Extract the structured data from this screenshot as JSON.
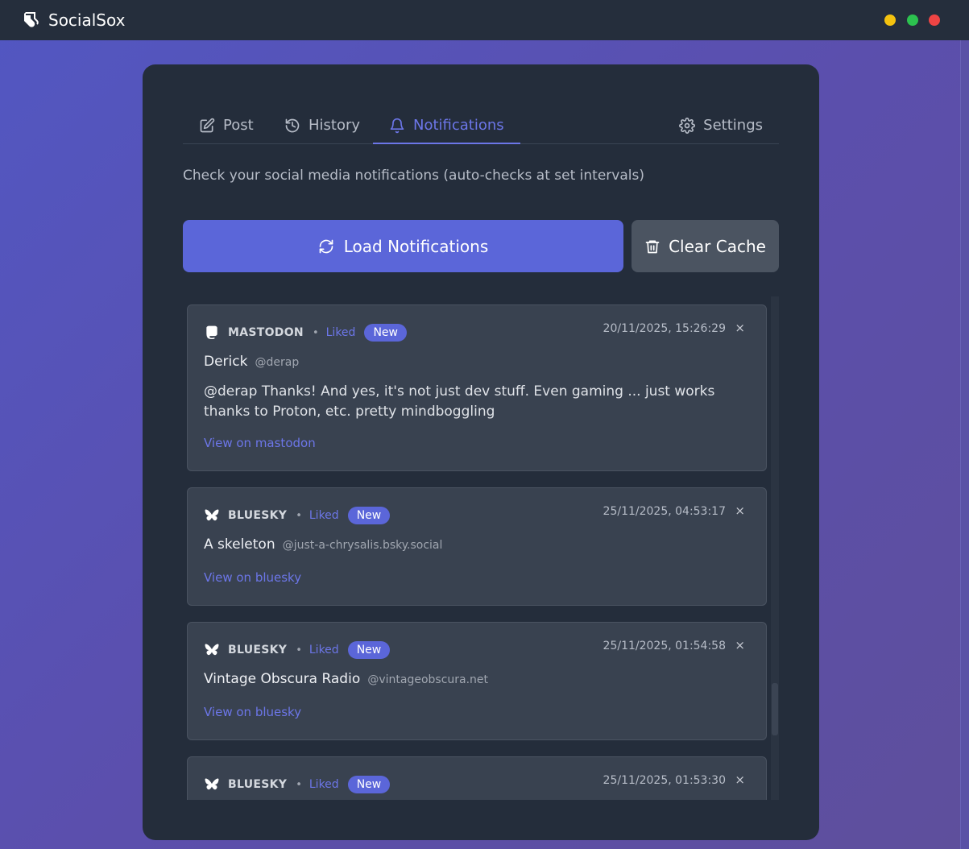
{
  "window": {
    "title": "SocialSox",
    "controls": [
      "minimize",
      "maximize",
      "close"
    ]
  },
  "tabs": [
    {
      "label": "Post",
      "icon": "edit-icon",
      "active": false
    },
    {
      "label": "History",
      "icon": "history-icon",
      "active": false
    },
    {
      "label": "Notifications",
      "icon": "bell-icon",
      "active": true
    },
    {
      "label": "Settings",
      "icon": "gear-icon",
      "active": false
    }
  ],
  "subtitle": "Check your social media notifications (auto-checks at set intervals)",
  "buttons": {
    "load": "Load Notifications",
    "clear": "Clear Cache"
  },
  "notifications": [
    {
      "platform": "MASTODON",
      "platform_icon": "mastodon-icon",
      "action": "Liked",
      "badge": "New",
      "timestamp": "20/11/2025, 15:26:29",
      "close": "×",
      "author": "Derick",
      "handle": "@derap",
      "text": "@derap Thanks! And yes, it's not just dev stuff. Even gaming ... just works thanks to Proton, etc. pretty mindboggling",
      "link": "View on mastodon"
    },
    {
      "platform": "BLUESKY",
      "platform_icon": "bluesky-butterfly-icon",
      "action": "Liked",
      "badge": "New",
      "timestamp": "25/11/2025, 04:53:17",
      "close": "×",
      "author": "A skeleton",
      "handle": "@just-a-chrysalis.bsky.social",
      "link": "View on bluesky"
    },
    {
      "platform": "BLUESKY",
      "platform_icon": "bluesky-butterfly-icon",
      "action": "Liked",
      "badge": "New",
      "timestamp": "25/11/2025, 01:54:58",
      "close": "×",
      "author": "Vintage Obscura Radio",
      "handle": "@vintageobscura.net",
      "link": "View on bluesky"
    },
    {
      "platform": "BLUESKY",
      "platform_icon": "bluesky-butterfly-icon",
      "action": "Liked",
      "badge": "New",
      "timestamp": "25/11/2025, 01:53:30",
      "close": "×"
    }
  ],
  "colors": {
    "accent": "#5b66d9",
    "accent_text": "#6c76e8",
    "card_bg": "#242d3b",
    "item_bg": "#394250",
    "titlebar_bg": "#252e3c"
  }
}
